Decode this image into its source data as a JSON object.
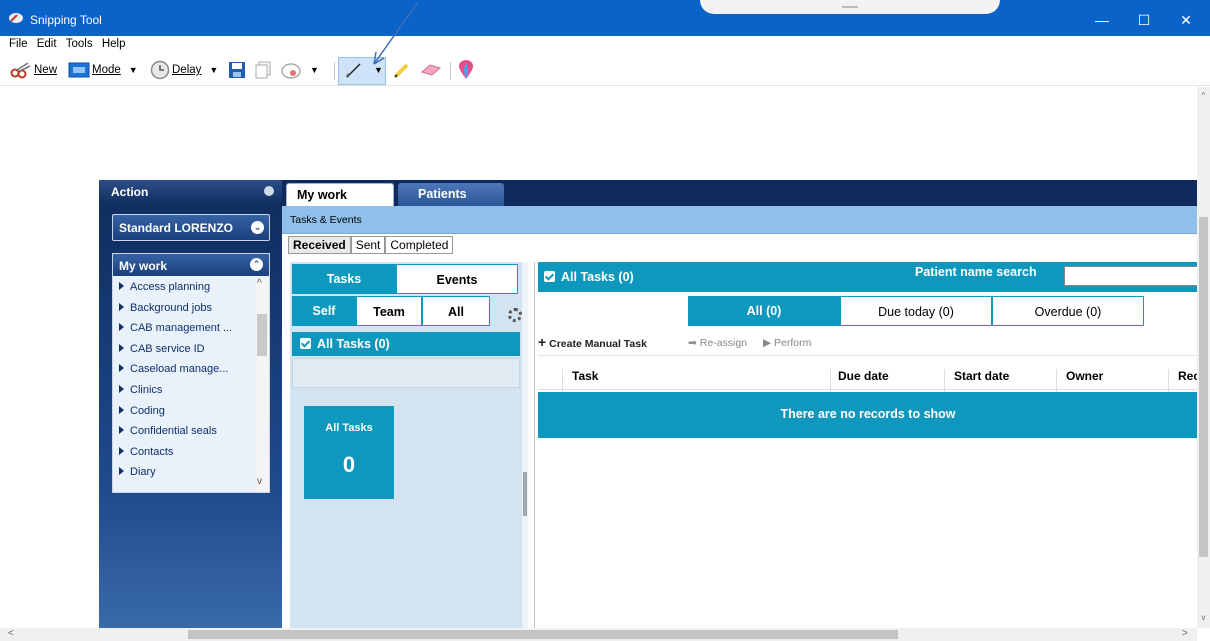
{
  "window": {
    "title": "Snipping Tool",
    "minimize_glyph": "—",
    "maximize_glyph": "☐",
    "close_glyph": "✕"
  },
  "menu": [
    "File",
    "Edit",
    "Tools",
    "Help"
  ],
  "toolbar": {
    "new_label": "New",
    "mode_label": "Mode",
    "delay_label": "Delay",
    "icons": [
      "scissors-icon",
      "mode-icon",
      "clock-icon",
      "save-icon",
      "copy-icon",
      "send-icon",
      "pen-icon",
      "highlighter-icon",
      "eraser-icon",
      "paint3d-icon"
    ]
  },
  "app": {
    "left": {
      "action_title": "Action",
      "standard_label": "Standard LORENZO",
      "mywork_title": "My work",
      "items": [
        "Access planning",
        "Background jobs",
        "CAB management ...",
        "CAB service ID",
        "Caseload manage...",
        "Clinics",
        "Coding",
        "Confidential seals",
        "Contacts",
        "Diary"
      ]
    },
    "tabs": [
      "My work",
      "Patients"
    ],
    "section_title": "Tasks & Events",
    "subtabs": [
      "Received",
      "Sent",
      "Completed"
    ],
    "toggle": {
      "tasks": "Tasks",
      "events": "Events"
    },
    "scope": {
      "self": "Self",
      "team": "Team",
      "all": "All"
    },
    "all_tasks_row": "All Tasks (0)",
    "tile": {
      "label": "All Tasks",
      "count": "0"
    },
    "list": {
      "header": "All Tasks (0)",
      "patient_search_label": "Patient name search",
      "patient_search_value": "",
      "filters": [
        "All (0)",
        "Due today (0)",
        "Overdue (0)"
      ],
      "actions": {
        "create": "Create Manual Task",
        "reassign": "Re-assign",
        "perform": "Perform"
      },
      "columns": [
        "Task",
        "Due date",
        "Start date",
        "Owner",
        "Rec"
      ],
      "empty_message": "There are no records to show"
    }
  },
  "colors": {
    "title_bar": "#0a63c9",
    "teal": "#0e98bd",
    "navy": "#0f2a5c",
    "light_blue_bar": "#8fc0ea"
  }
}
